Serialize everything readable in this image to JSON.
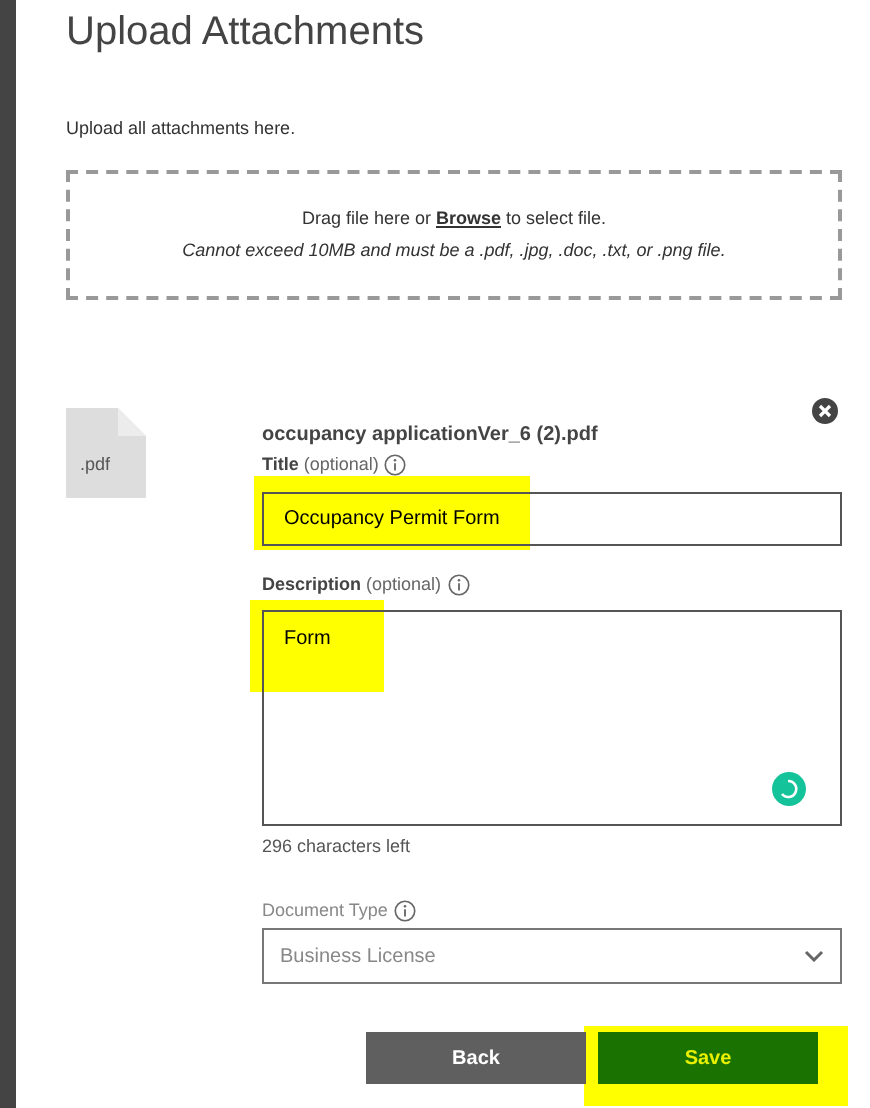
{
  "heading": "Upload Attachments",
  "intro": "Upload all attachments here.",
  "dropzone": {
    "line_1": "Drag file here or **Browse** to select file.",
    "line_2": "Cannot exceed 10MB and must be a .pdf, .jpg, .doc, .txt, or .png file."
  },
  "file": {
    "extension": ".pdf",
    "name": "occupancy applicationVer_6 (2).pdf"
  },
  "title_field": {
    "label": "Title",
    "hint": "(optional)",
    "value": "Occupancy Permit Form",
    "highlighted": true
  },
  "description_field": {
    "label": "Description",
    "hint": "(optional)",
    "value": "Form",
    "highlighted": true
  },
  "characters_left": "296 characters left",
  "document_type": {
    "label": "Document Type",
    "value": "Business License",
    "disabled": true
  },
  "buttons": [
    {
      "label": "Back",
      "kind": "back",
      "highlighted": false
    },
    {
      "label": "Save",
      "kind": "save",
      "highlighted": true
    }
  ]
}
